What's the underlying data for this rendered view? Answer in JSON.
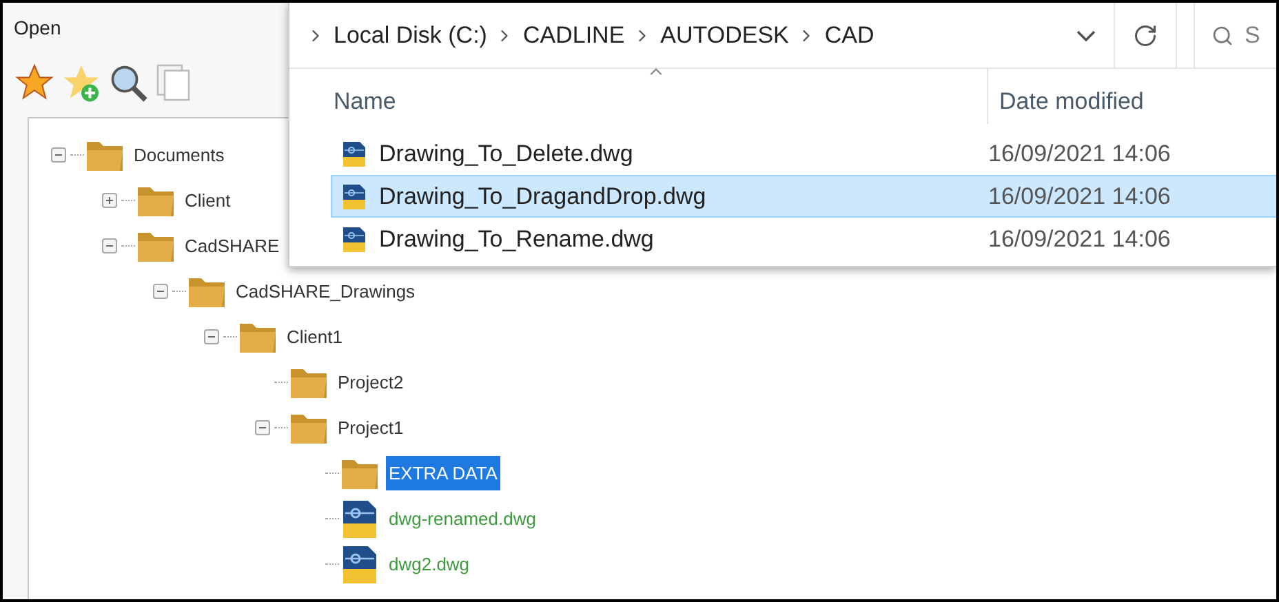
{
  "dialog": {
    "title": "Open"
  },
  "tree": [
    {
      "label": "Documents",
      "kind": "folder",
      "expanded": true,
      "selected": false,
      "children": [
        {
          "label": "Client",
          "kind": "folder",
          "expanded": false,
          "selected": false
        },
        {
          "label": "CadSHARE",
          "kind": "folder",
          "expanded": true,
          "selected": false,
          "children": [
            {
              "label": "CadSHARE_Drawings",
              "kind": "folder",
              "expanded": true,
              "selected": false,
              "children": [
                {
                  "label": "Client1",
                  "kind": "folder",
                  "expanded": true,
                  "selected": false,
                  "children": [
                    {
                      "label": "Project2",
                      "kind": "folder",
                      "selected": false
                    },
                    {
                      "label": "Project1",
                      "kind": "folder",
                      "expanded": true,
                      "selected": false,
                      "children": [
                        {
                          "label": "EXTRA DATA",
                          "kind": "folder",
                          "selected": true
                        },
                        {
                          "label": "dwg-renamed.dwg",
                          "kind": "file",
                          "selected": false
                        },
                        {
                          "label": "dwg2.dwg",
                          "kind": "file",
                          "selected": false
                        }
                      ]
                    }
                  ]
                }
              ]
            }
          ]
        }
      ]
    }
  ],
  "explorer": {
    "breadcrumb": [
      "Local Disk (C:)",
      "CADLINE",
      "AUTODESK",
      "CAD"
    ],
    "search": {
      "placeholder": "S"
    },
    "columns": [
      "Name",
      "Date modified"
    ],
    "rows": [
      {
        "name": "Drawing_To_Delete.dwg",
        "date": "16/09/2021 14:06",
        "selected": false
      },
      {
        "name": "Drawing_To_DragandDrop.dwg",
        "date": "16/09/2021 14:06",
        "selected": true
      },
      {
        "name": "Drawing_To_Rename.dwg",
        "date": "16/09/2021 14:06",
        "selected": false
      }
    ]
  }
}
